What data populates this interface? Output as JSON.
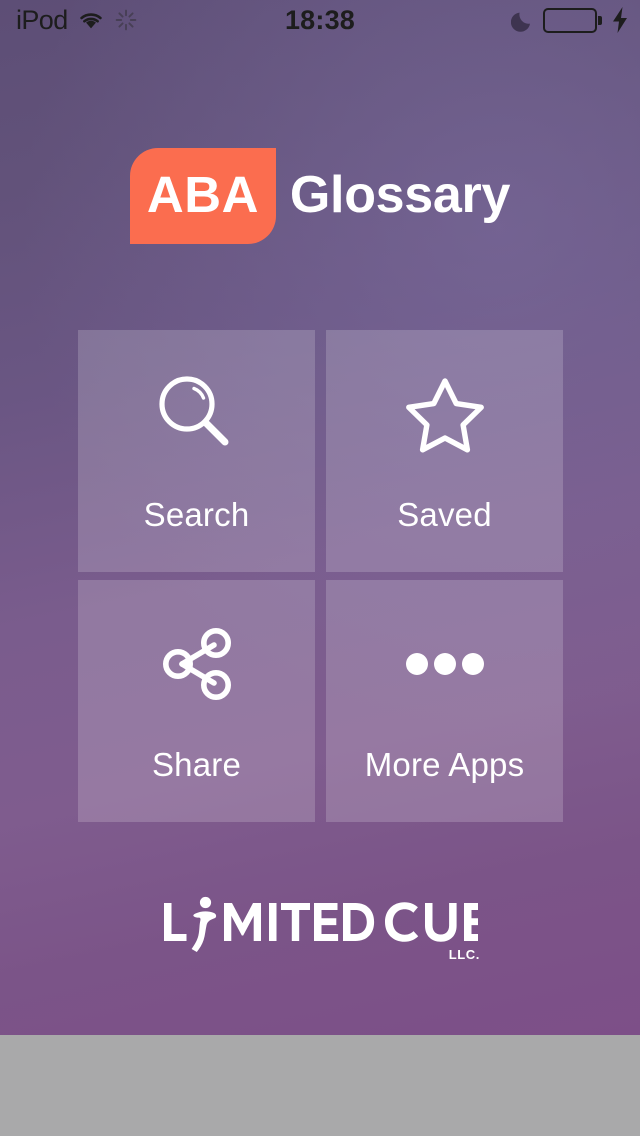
{
  "status_bar": {
    "carrier": "iPod",
    "time": "18:38",
    "wifi_icon": "wifi-icon",
    "activity_icon": "activity-spinner-icon",
    "dnd_icon": "moon-icon",
    "battery_icon": "battery-icon",
    "charging_icon": "lightning-bolt-icon",
    "battery_color": "#4cd964"
  },
  "logo": {
    "badge_text": "ABA",
    "word": "Glossary",
    "badge_color": "#fb6d4f",
    "text_color": "#ffffff"
  },
  "tiles": [
    {
      "label": "Search",
      "icon": "magnifier-icon"
    },
    {
      "label": "Saved",
      "icon": "star-outline-icon"
    },
    {
      "label": "Share",
      "icon": "share-nodes-icon"
    },
    {
      "label": "More Apps",
      "icon": "ellipsis-icon"
    }
  ],
  "brand": {
    "name": "LIMITEDCUE",
    "suffix": "LLC.",
    "mark": "dancing-figure-icon"
  },
  "theme": {
    "background_top": "#5d4e76",
    "background_bottom": "#7d4f88",
    "tile_overlay": "rgba(255,255,255,0.18)",
    "bezel": "#a9a9aa"
  }
}
